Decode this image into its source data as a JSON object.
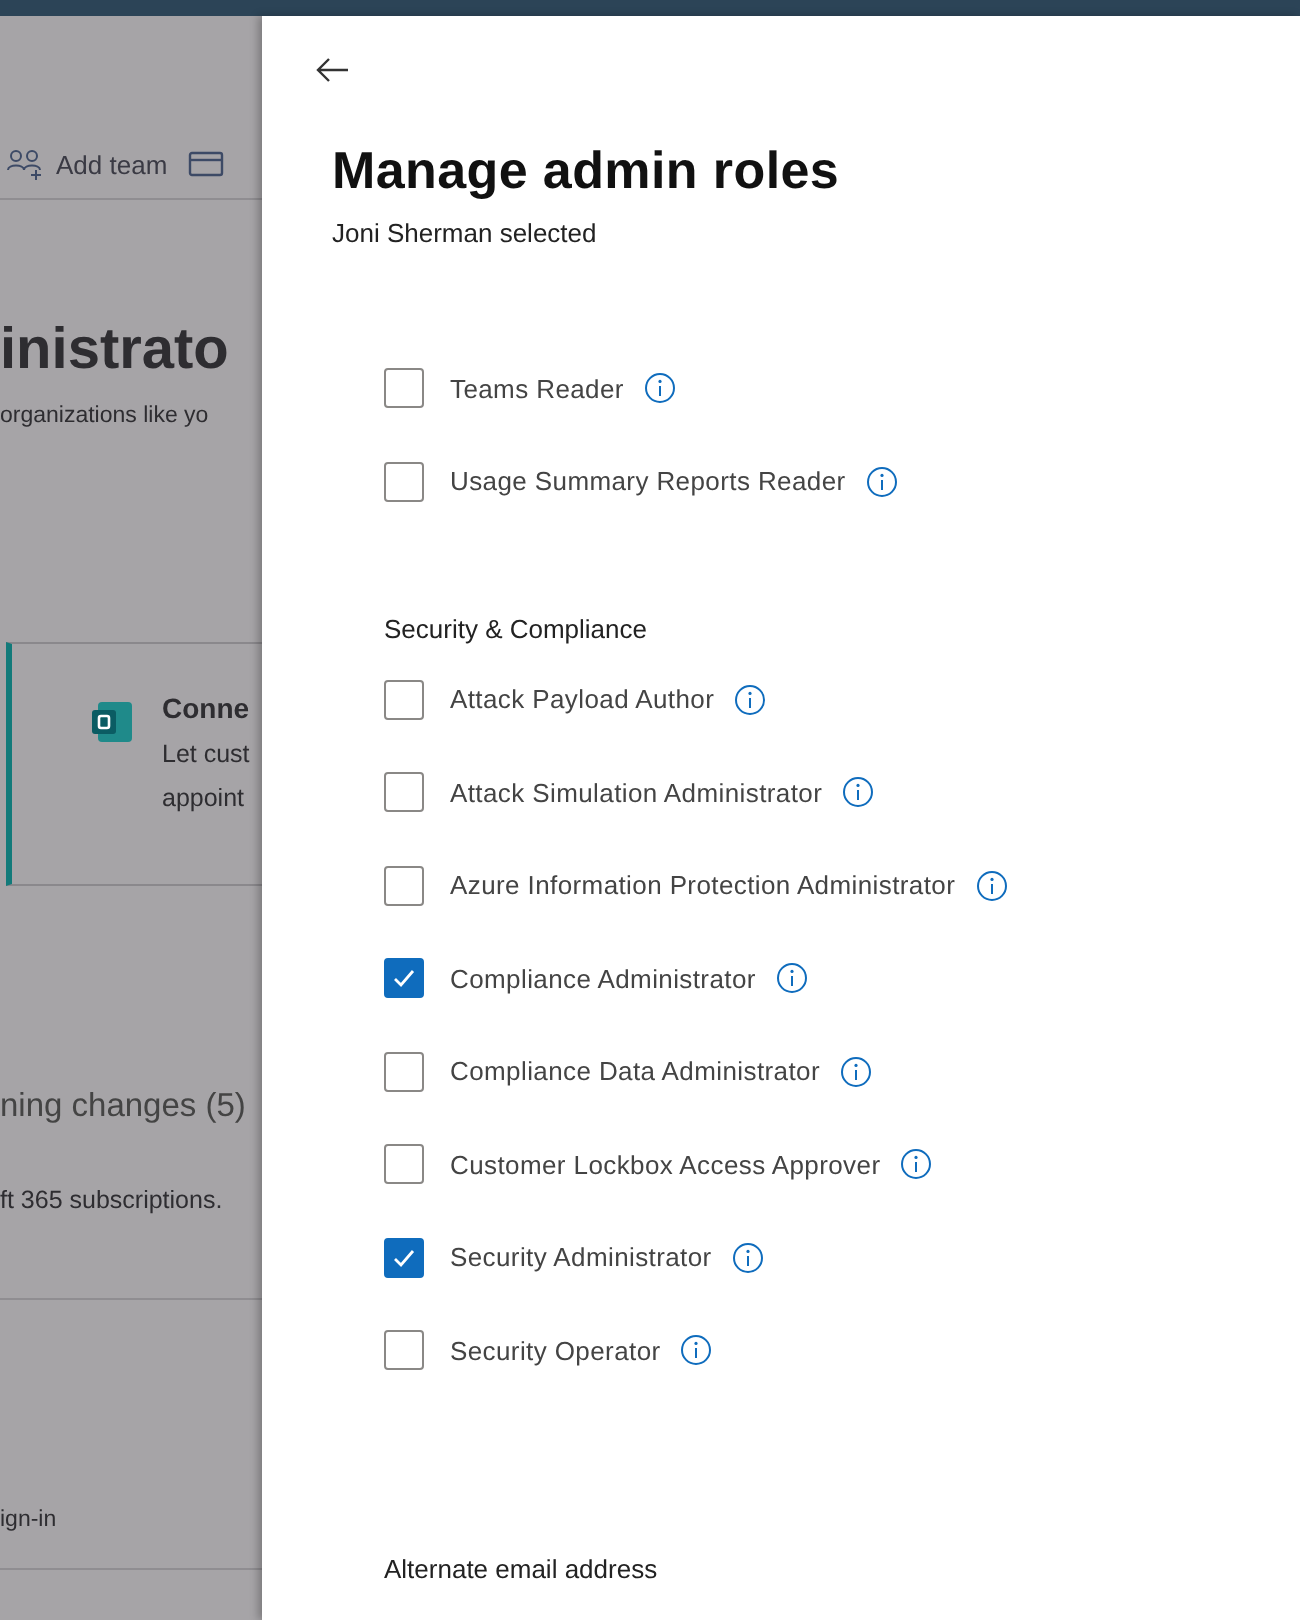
{
  "background_page": {
    "toolbar": {
      "add_team": "Add team"
    },
    "heading": "inistrato",
    "description": "organizations like yo",
    "card": {
      "title": "Conne",
      "lines": [
        "Let cust",
        "appoint"
      ]
    },
    "changes_heading": "ning changes (5)",
    "changes_text": "ft 365 subscriptions.",
    "footer_link": "ign-in"
  },
  "panel": {
    "title": "Manage admin roles",
    "subtitle": "Joni Sherman selected",
    "sections": [
      {
        "roles": [
          {
            "label": "Teams Reader",
            "checked": false
          },
          {
            "label": "Usage Summary Reports Reader",
            "checked": false
          }
        ]
      },
      {
        "heading": "Security & Compliance",
        "roles": [
          {
            "label": "Attack Payload Author",
            "checked": false
          },
          {
            "label": "Attack Simulation Administrator",
            "checked": false
          },
          {
            "label": "Azure Information Protection Administrator",
            "checked": false
          },
          {
            "label": "Compliance Administrator",
            "checked": true
          },
          {
            "label": "Compliance Data Administrator",
            "checked": false
          },
          {
            "label": "Customer Lockbox Access Approver",
            "checked": false
          },
          {
            "label": "Security Administrator",
            "checked": true
          },
          {
            "label": "Security Operator",
            "checked": false
          }
        ]
      }
    ],
    "alternate_email_label": "Alternate email address"
  }
}
